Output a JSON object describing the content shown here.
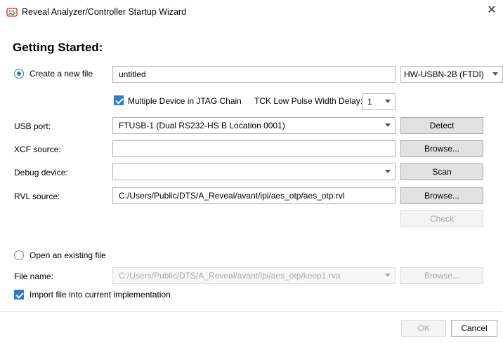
{
  "window": {
    "title": "Reveal Analyzer/Controller Startup Wizard",
    "close_glyph": "✕"
  },
  "heading": "Getting Started:",
  "create_new": {
    "label": "Create a new file",
    "selected": true,
    "filename_value": "untitled",
    "cable_select": "HW-USBN-2B (FTDI)"
  },
  "jtag": {
    "multiple_device_label": "Multiple Device in JTAG Chain",
    "multiple_device_checked": true,
    "tck_label": "TCK Low Pulse Width Delay:",
    "tck_value": "1"
  },
  "rows": {
    "usb_port": {
      "label": "USB port:",
      "value": "FTUSB-1 (Dual RS232-HS B Location 0001)",
      "button": "Detect"
    },
    "xcf_source": {
      "label": "XCF source:",
      "value": "",
      "button": "Browse..."
    },
    "debug_device": {
      "label": "Debug device:",
      "value": "",
      "button": "Scan"
    },
    "rvl_source": {
      "label": "RVL source:",
      "value": "C:/Users/Public/DTS/A_Reveal/avant/ipi/aes_otp/aes_otp.rvl",
      "button": "Browse..."
    },
    "check_button": "Check"
  },
  "open_existing": {
    "label": "Open an existing file",
    "selected": false,
    "file_name_label": "File name:",
    "file_name_value": "C:/Users/Public/DTS/A_Reveal/avant/ipi/aes_otp/keep1.rva",
    "browse_button": "Browse..."
  },
  "import": {
    "label": "Import file into current implementation",
    "checked": true
  },
  "footer": {
    "ok": "OK",
    "cancel": "Cancel"
  },
  "colors": {
    "accent": "#2b7cd3",
    "button_bg": "#e1e1e1",
    "disabled_text": "#a0a0a0"
  }
}
